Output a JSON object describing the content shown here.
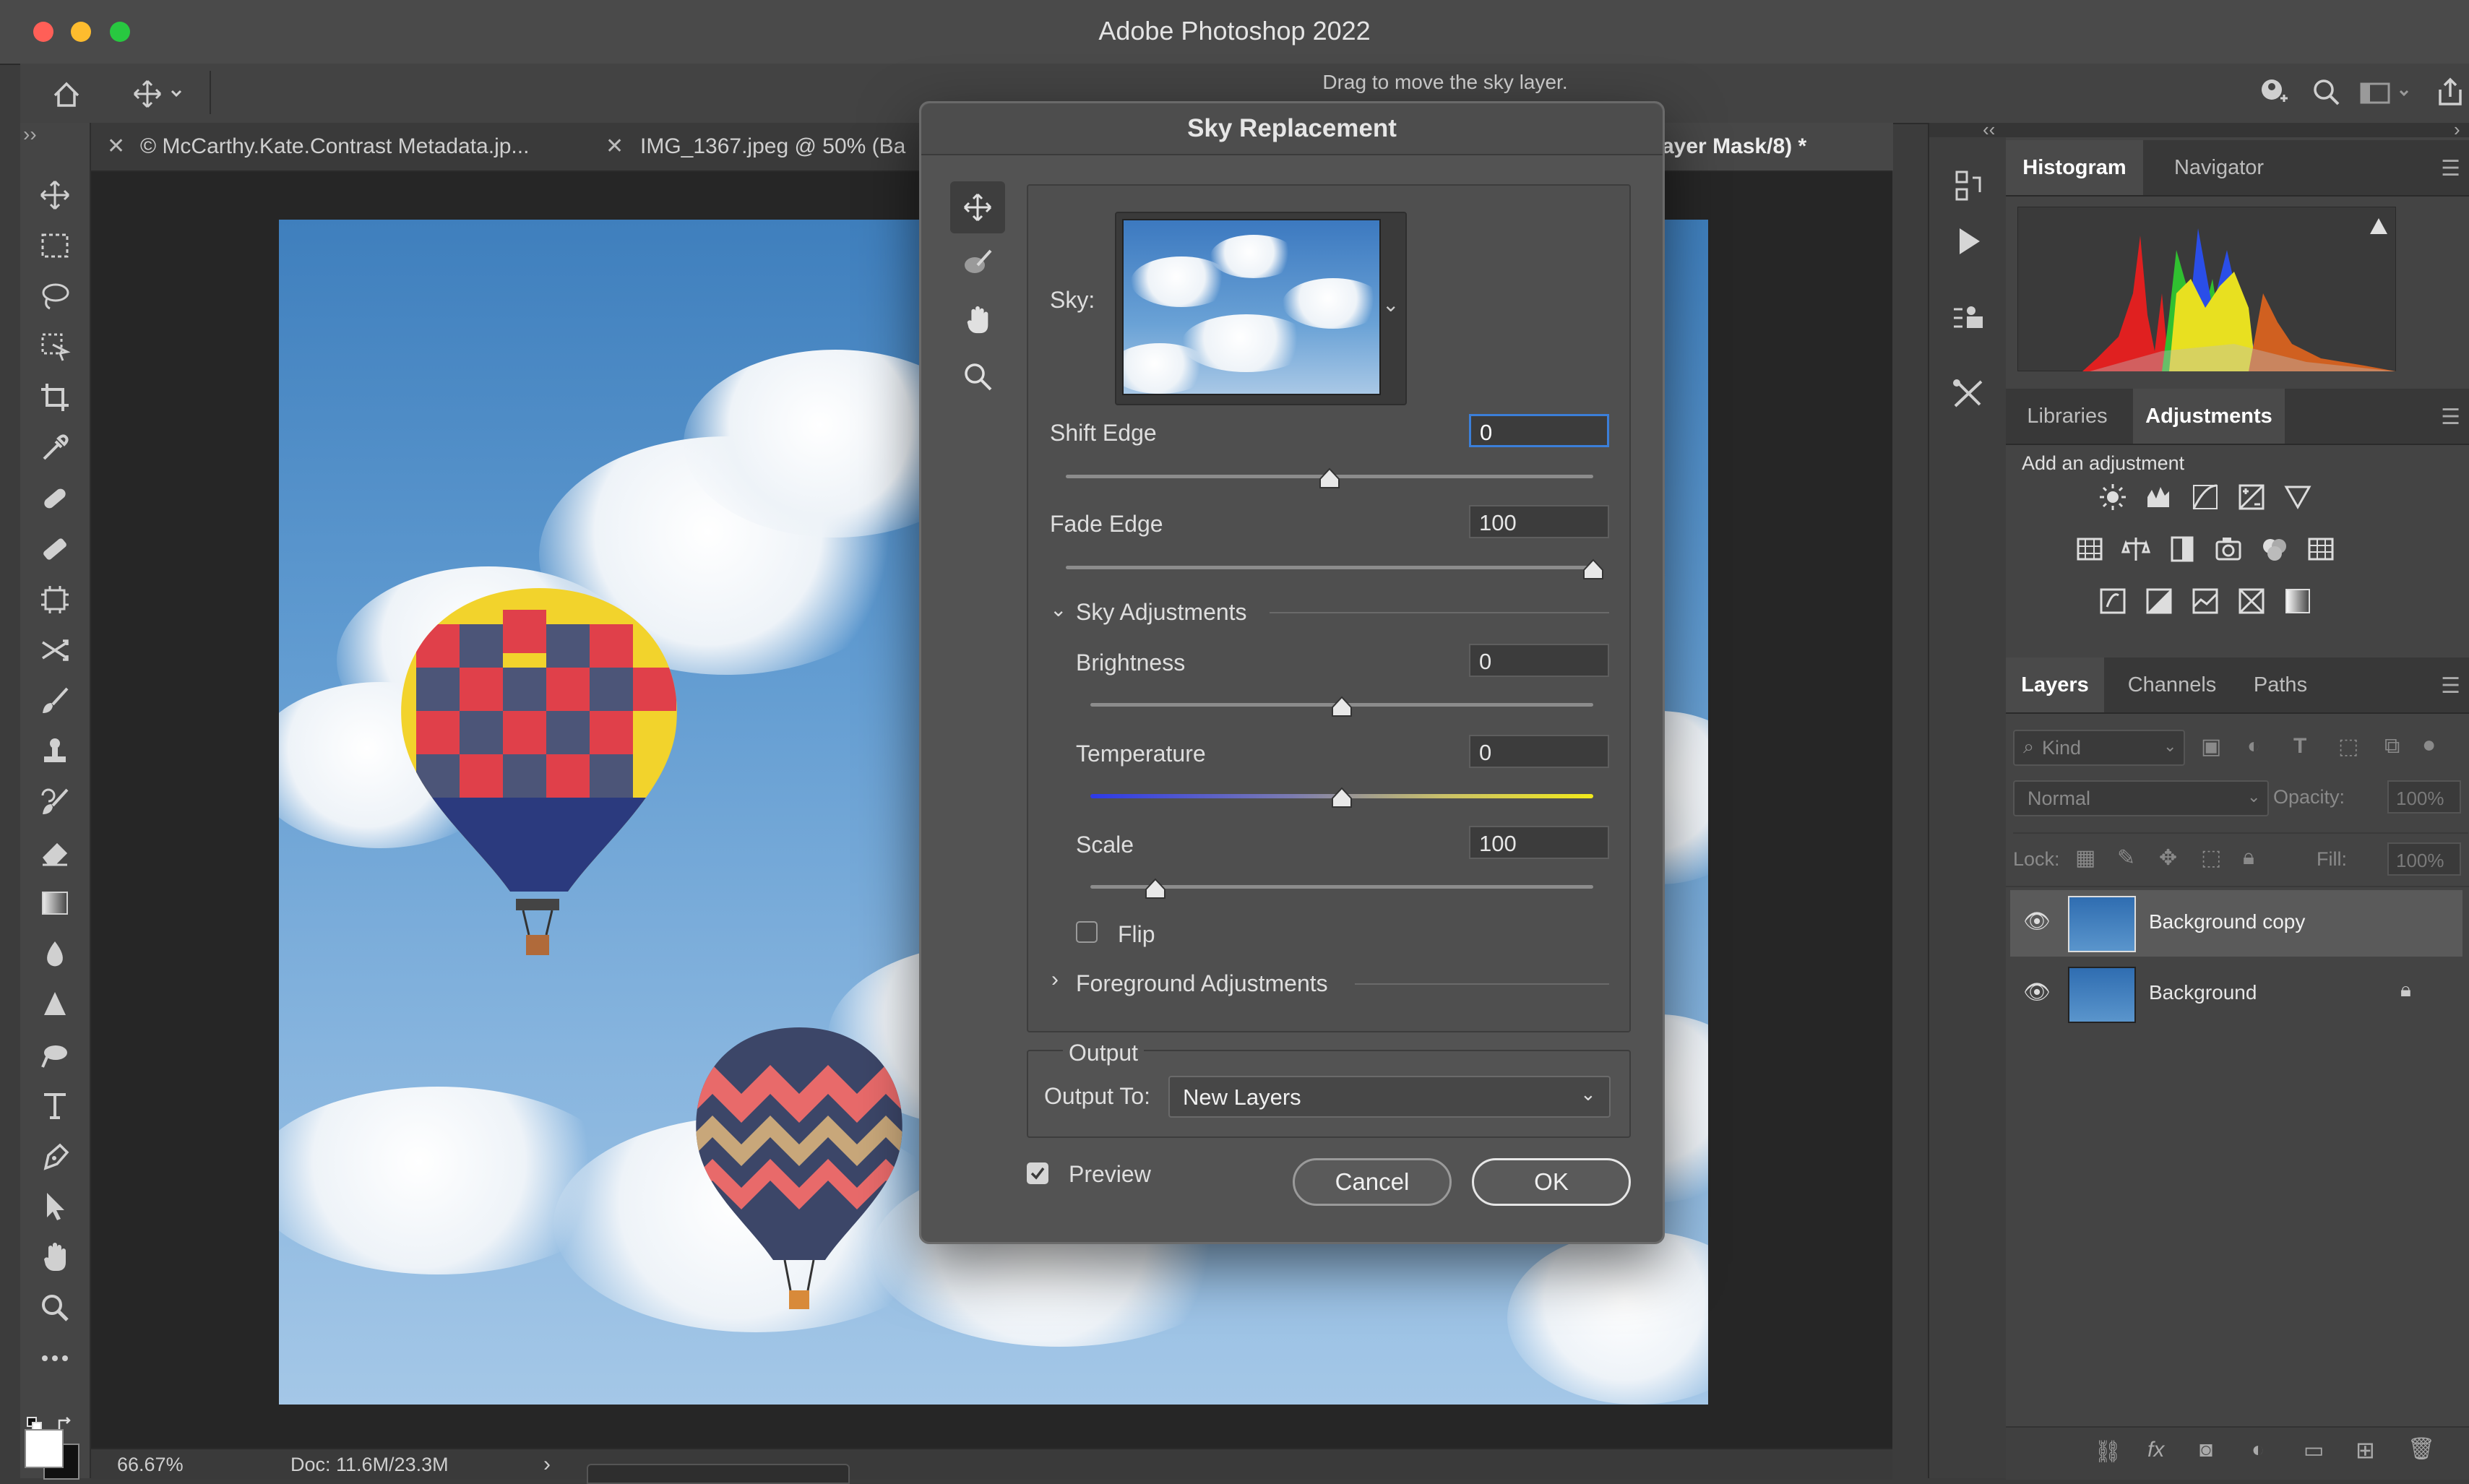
{
  "window": {
    "title": "Adobe Photoshop 2022",
    "colors": {
      "close": "#ff5f57",
      "minimize": "#febc2e",
      "zoom": "#28c840"
    }
  },
  "options_bar": {
    "hint": "Drag to move the sky layer."
  },
  "tabs": [
    {
      "label": "© McCarthy.Kate.Contrast Metadata.jp..."
    },
    {
      "label": "IMG_1367.jpeg @ 50% (Ba"
    },
    {
      "label": "ayer Mask/8) *"
    }
  ],
  "status": {
    "zoom": "66.67%",
    "doc": "Doc: 11.6M/23.3M"
  },
  "dialog": {
    "title": "Sky Replacement",
    "sky_label": "Sky:",
    "shift_edge": {
      "label": "Shift Edge",
      "value": "0",
      "slider": 0.5
    },
    "fade_edge": {
      "label": "Fade Edge",
      "value": "100",
      "slider": 1.0
    },
    "sky_adjustments": {
      "label": "Sky Adjustments"
    },
    "brightness": {
      "label": "Brightness",
      "value": "0",
      "slider": 0.5
    },
    "temperature": {
      "label": "Temperature",
      "value": "0",
      "slider": 0.5
    },
    "scale": {
      "label": "Scale",
      "value": "100",
      "slider": 0.13
    },
    "flip": {
      "label": "Flip",
      "checked": false
    },
    "foreground_adjustments": {
      "label": "Foreground Adjustments"
    },
    "output": {
      "label": "Output",
      "output_to_label": "Output To:",
      "output_to_value": "New Layers"
    },
    "preview": {
      "label": "Preview",
      "checked": true
    },
    "cancel": "Cancel",
    "ok": "OK"
  },
  "panels": {
    "histogram_tabs": [
      "Histogram",
      "Navigator"
    ],
    "adjust_tabs": [
      "Libraries",
      "Adjustments"
    ],
    "add_adjustment": "Add an adjustment",
    "layers_tabs": [
      "Layers",
      "Channels",
      "Paths"
    ],
    "kind_placeholder": "Kind",
    "blend_mode": "Normal",
    "opacity_label": "Opacity:",
    "opacity_value": "100%",
    "lock_label": "Lock:",
    "fill_label": "Fill:",
    "fill_value": "100%",
    "layers": [
      {
        "name": "Background copy",
        "selected": true,
        "locked": false
      },
      {
        "name": "Background",
        "selected": false,
        "locked": true
      }
    ]
  }
}
